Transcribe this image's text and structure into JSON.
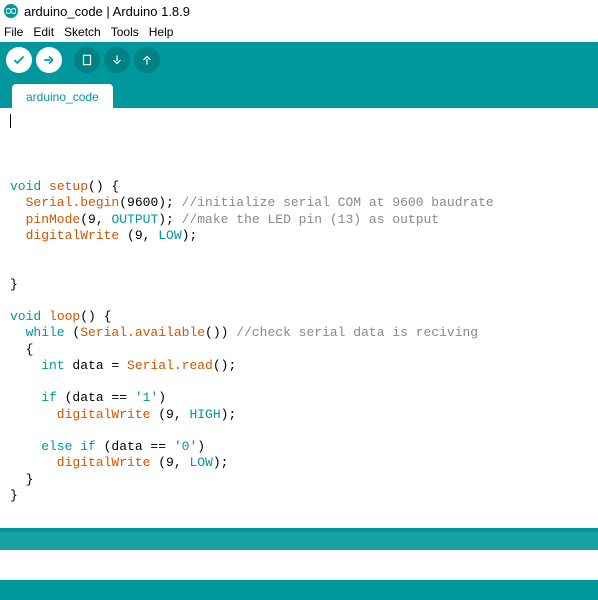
{
  "window": {
    "title": "arduino_code | Arduino 1.8.9"
  },
  "menu": {
    "file": "File",
    "edit": "Edit",
    "sketch": "Sketch",
    "tools": "Tools",
    "help": "Help"
  },
  "toolbar_icons": {
    "verify": "verify-icon",
    "upload": "upload-icon",
    "new": "new-icon",
    "open": "open-icon",
    "save": "save-icon"
  },
  "tab": {
    "name": "arduino_code"
  },
  "code": {
    "l1": "",
    "l2": "",
    "setup_sig_void": "void",
    "setup_sig_name": " setup",
    "setup_sig_rest": "() {",
    "setup_serial_obj": "  Serial",
    "setup_serial_begin": ".begin",
    "setup_serial_args": "(9600); ",
    "setup_serial_cm": "//initialize serial COM at 9600 baudrate",
    "setup_pinmode_fn": "  pinMode",
    "setup_pinmode_open": "(9, ",
    "setup_pinmode_const": "OUTPUT",
    "setup_pinmode_close": "); ",
    "setup_pinmode_cm": "//make the LED pin (13) as output",
    "setup_dw_fn": "  digitalWrite",
    "setup_dw_open": " (9, ",
    "setup_dw_const": "LOW",
    "setup_dw_close": ");",
    "setup_blank": "  ",
    "close_brace": "}",
    "loop_sig_void": "void",
    "loop_sig_name": " loop",
    "loop_sig_rest": "() {",
    "loop_while_kw": "  while",
    "loop_while_open": " (",
    "loop_while_obj": "Serial",
    "loop_while_avail": ".available",
    "loop_while_close": "()) ",
    "loop_while_cm": "//check serial data is reciving",
    "loop_brace_open": "  {",
    "loop_data_ty": "    int",
    "loop_data_eq": " data = ",
    "loop_data_obj": "Serial",
    "loop_data_read": ".read",
    "loop_data_close": "();",
    "loop_blank2": "    ",
    "loop_if_kw": "    if",
    "loop_if_open": " (data == ",
    "loop_if_str": "'1'",
    "loop_if_close": ")",
    "loop_if_dw": "      digitalWrite",
    "loop_if_dw_open": " (9, ",
    "loop_if_dw_const": "HIGH",
    "loop_if_dw_close": ");",
    "loop_else_kw": "    else if",
    "loop_else_open": " (data == ",
    "loop_else_str": "'0'",
    "loop_else_close": ")",
    "loop_else_dw": "      digitalWrite",
    "loop_else_dw_open": " (9, ",
    "loop_else_dw_const": "LOW",
    "loop_else_dw_close": ");",
    "loop_brace_close": "  }",
    "final_close": "}"
  }
}
